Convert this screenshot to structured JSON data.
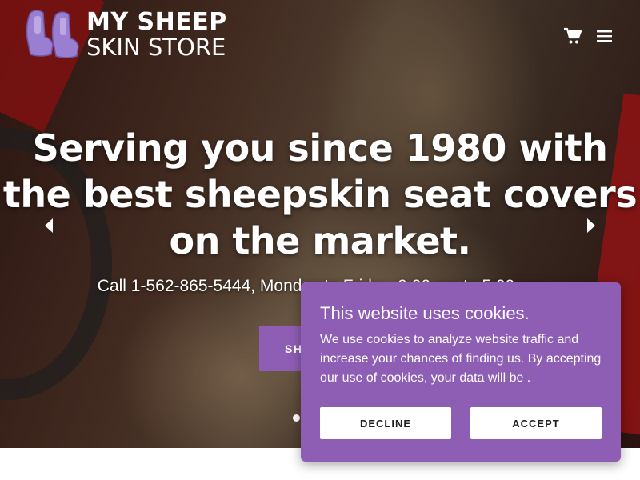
{
  "brand": {
    "line1": "MY SHEEP",
    "line2": "SKIN STORE",
    "logo_icon": "car-seats-icon"
  },
  "header": {
    "cart_icon": "cart-icon",
    "menu_icon": "hamburger-menu-icon"
  },
  "hero": {
    "headline": "Serving you since 1980 with the best sheepskin seat covers on the market.",
    "subline": "Call 1-562-865-5444, Monday to Friday, 9:00 am to 5:00 pm",
    "button_label": "SHOP NOW",
    "slide_count": 2,
    "active_slide": 1
  },
  "cookie_banner": {
    "title": "This website uses cookies.",
    "body": "We use cookies to analyze website traffic and increase your chances of finding us. By accepting our use of cookies, your data will be .",
    "decline_label": "DECLINE",
    "accept_label": "ACCEPT"
  },
  "colors": {
    "accent": "#8e5db4",
    "text_on_accent": "#ffffff"
  }
}
